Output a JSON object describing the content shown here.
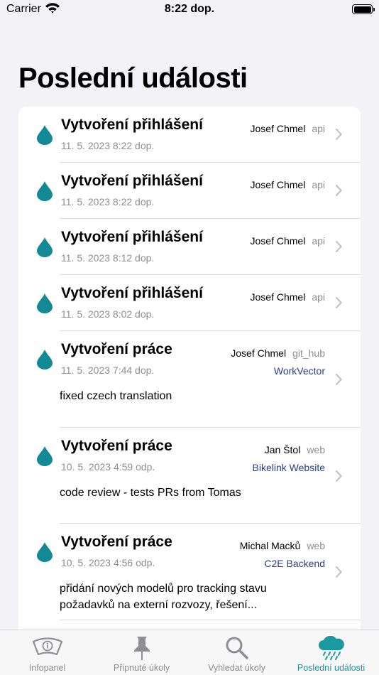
{
  "status_bar": {
    "carrier": "Carrier",
    "time": "8:22 dop."
  },
  "page_title": "Poslední události",
  "colors": {
    "accent": "#1a9aa0",
    "drop": "#138a93",
    "project_link": "#2c3e8a",
    "secondary_text": "#8e8e93"
  },
  "events": [
    {
      "title": "Vytvoření přihlášení",
      "date": "11. 5. 2023 8:22 dop.",
      "user": "Josef Chmel",
      "source": "api",
      "project": "",
      "description": ""
    },
    {
      "title": "Vytvoření přihlášení",
      "date": "11. 5. 2023 8:22 dop.",
      "user": "Josef Chmel",
      "source": "api",
      "project": "",
      "description": ""
    },
    {
      "title": "Vytvoření přihlášení",
      "date": "11. 5. 2023 8:12 dop.",
      "user": "Josef Chmel",
      "source": "api",
      "project": "",
      "description": ""
    },
    {
      "title": "Vytvoření přihlášení",
      "date": "11. 5. 2023 8:02 dop.",
      "user": "Josef Chmel",
      "source": "api",
      "project": "",
      "description": ""
    },
    {
      "title": "Vytvoření práce",
      "date": "11. 5. 2023 7:44 dop.",
      "user": "Josef Chmel",
      "source": "git_hub",
      "project": "WorkVector",
      "description": "fixed czech translation"
    },
    {
      "title": "Vytvoření práce",
      "date": "10. 5. 2023 4:59 odp.",
      "user": "Jan Štol",
      "source": "web",
      "project": "Bikelink Website",
      "description": "code review - tests PRs from Tomas"
    },
    {
      "title": "Vytvoření práce",
      "date": "10. 5. 2023 4:56 odp.",
      "user": "Michal Macků",
      "source": "web",
      "project": "C2E Backend",
      "description": "přidání nových modelů pro tracking stavu požadavků na externí rozvozy, řešení..."
    }
  ],
  "tabs": [
    {
      "label": "Infopanel",
      "icon": "dashboard-gauge-icon"
    },
    {
      "label": "Připnuté úkoly",
      "icon": "pin-icon"
    },
    {
      "label": "Vyhledat úkoly",
      "icon": "magnifier-icon"
    },
    {
      "label": "Poslední události",
      "icon": "cloud-rain-icon",
      "active": true
    }
  ]
}
